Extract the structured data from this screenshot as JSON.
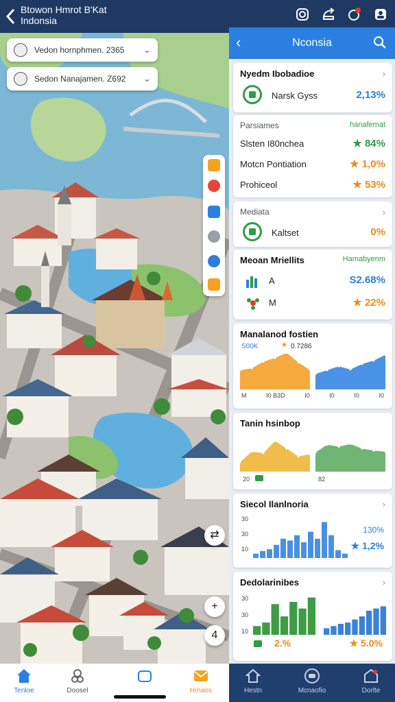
{
  "header": {
    "title_line1": "Btowon Hmrot B'Kat",
    "title_line2": "Indonsia"
  },
  "map": {
    "location_cards": [
      {
        "label": "Vedon hornphmen.  2365"
      },
      {
        "label": "Sedon Nanajamen.  Z692"
      }
    ],
    "fab_top": "⇄",
    "fab_zoom": "+",
    "fab_bottom": "4"
  },
  "panel": {
    "title": "Nconsia",
    "cards": {
      "system": {
        "title": "Nyedm Ibobadioe",
        "item_label": "Narsk Gyss",
        "item_value": "2,13%"
      },
      "parishes": {
        "title": "Parsiames",
        "title_right": "hanafemat",
        "rows": [
          {
            "label": "Slsten I80nchea",
            "value": "84%",
            "color": "#2e9c45"
          },
          {
            "label": "Motcn Pontiation",
            "value": "1,0%",
            "color": "#f08a16"
          },
          {
            "label": "Prohiceol",
            "value": "53%",
            "color": "#f08a16"
          }
        ]
      },
      "mediata": {
        "title": "Mediata",
        "item_label": "Kaltset",
        "item_value": "0%"
      },
      "metrics": {
        "title": "Meoan Mriellits",
        "title_right": "Hamabyenm",
        "rows": [
          {
            "label": "A",
            "value": "S2.68%",
            "color": "#2a7fe0"
          },
          {
            "label": "M",
            "value": "22%",
            "color": "#f08a16"
          }
        ]
      },
      "management": {
        "title": "Manalanod fostien",
        "annotation_left": "S00K",
        "annotation_right": "0.7286",
        "tick_labels": [
          "M",
          "I0 B3D",
          "I0",
          "I0",
          "I0",
          "I0"
        ]
      },
      "tanin": {
        "title": "Tanin hsinbop",
        "tick_labels": [
          "20",
          "82"
        ]
      },
      "stool": {
        "title": "Siecol Ilanlnoria",
        "y_ticks": [
          "30",
          "30",
          "10"
        ],
        "stat1": "130%",
        "stat2": "1,2%"
      },
      "decolar": {
        "title": "Dedolarinibes",
        "y_ticks": [
          "30",
          "30",
          "10"
        ],
        "stat1": "2.%",
        "stat2": "5.0%"
      }
    }
  },
  "chart_data": [
    {
      "type": "area",
      "title": "Manalanod fostien",
      "series": [
        {
          "values": [
            50,
            55,
            72,
            82,
            95,
            70,
            50
          ]
        },
        {
          "values": [
            40,
            50,
            60,
            52,
            66,
            75,
            90
          ]
        }
      ]
    },
    {
      "type": "area",
      "title": "Tanin hsinbop",
      "series": [
        {
          "values": [
            25,
            52,
            48,
            80,
            60,
            40,
            45
          ]
        },
        {
          "values": [
            50,
            70,
            65,
            72,
            60,
            55,
            52
          ]
        }
      ]
    },
    {
      "type": "bar",
      "title": "Siecol Ilanlnoria",
      "series": [
        {
          "values": [
            10,
            16,
            20,
            30,
            44,
            40,
            52,
            36,
            60,
            44,
            82,
            52,
            18,
            10
          ]
        }
      ]
    },
    {
      "type": "bar",
      "title": "Dedolarinibes",
      "series": [
        {
          "values": [
            20,
            28,
            70,
            42,
            75,
            60,
            85
          ]
        },
        {
          "values": [
            15,
            20,
            25,
            28,
            35,
            42,
            55,
            60,
            65
          ]
        }
      ]
    }
  ],
  "bottom_nav_left": [
    {
      "label": "Tenloe"
    },
    {
      "label": "Doosel"
    },
    {
      "label": ""
    },
    {
      "label": "Hrnaos"
    }
  ],
  "bottom_nav_right": [
    {
      "label": "Hestn"
    },
    {
      "label": "Mcnaofio"
    },
    {
      "label": "Dorlte"
    }
  ],
  "colors": {
    "accent": "#2a7fe0",
    "header_dark": "#1e3a63",
    "green": "#2e9c45",
    "orange": "#f08a16"
  }
}
